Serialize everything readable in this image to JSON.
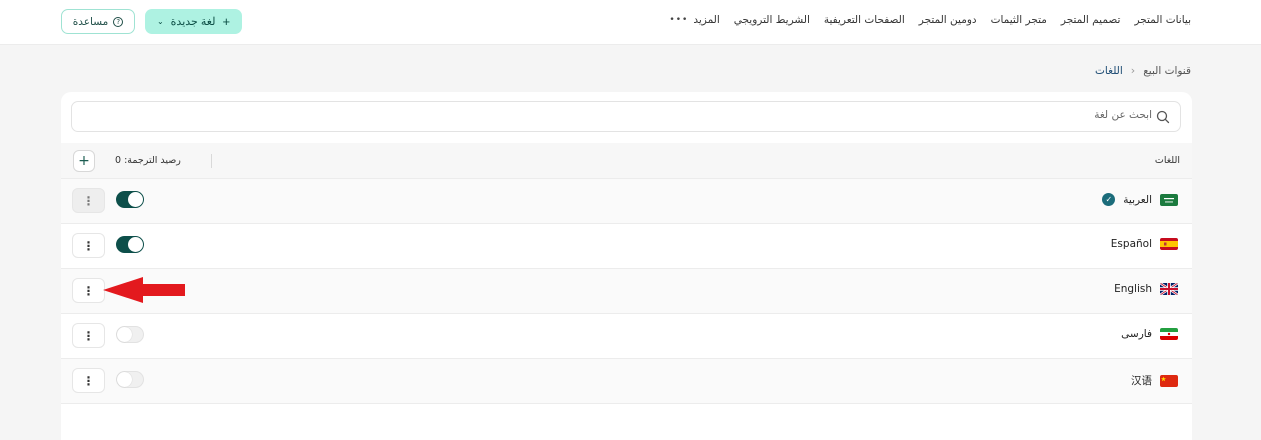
{
  "topnav": {
    "items": [
      "بيانات المتجر",
      "تصميم المتجر",
      "متجر الثيمات",
      "دومين المتجر",
      "الصفحات التعريفية",
      "الشريط الترويجي"
    ],
    "more_label": "المزيد"
  },
  "actions": {
    "new_language": "لغة جديدة",
    "help": "مساعدة"
  },
  "breadcrumb": {
    "parent": "قنوات البيع",
    "current": "اللغات"
  },
  "search": {
    "placeholder": "ابحث عن لغة"
  },
  "table": {
    "header_languages": "اللغات",
    "translation_credit": "رصيد الترجمة: 0",
    "rows": [
      {
        "name": "العربية",
        "flag": "sa-flag",
        "default": true,
        "enabled": true
      },
      {
        "name": "Español",
        "flag": "es-flag",
        "default": false,
        "enabled": true
      },
      {
        "name": "English",
        "flag": "gb-flag",
        "default": false,
        "enabled": null
      },
      {
        "name": "فارسی",
        "flag": "ir-flag",
        "default": false,
        "enabled": false
      },
      {
        "name": "汉语",
        "flag": "cn-flag",
        "default": false,
        "enabled": false
      }
    ]
  },
  "colors": {
    "accent": "#aef2e2",
    "toggle_on": "#0d4f4a",
    "arrow": "#e3191e"
  }
}
